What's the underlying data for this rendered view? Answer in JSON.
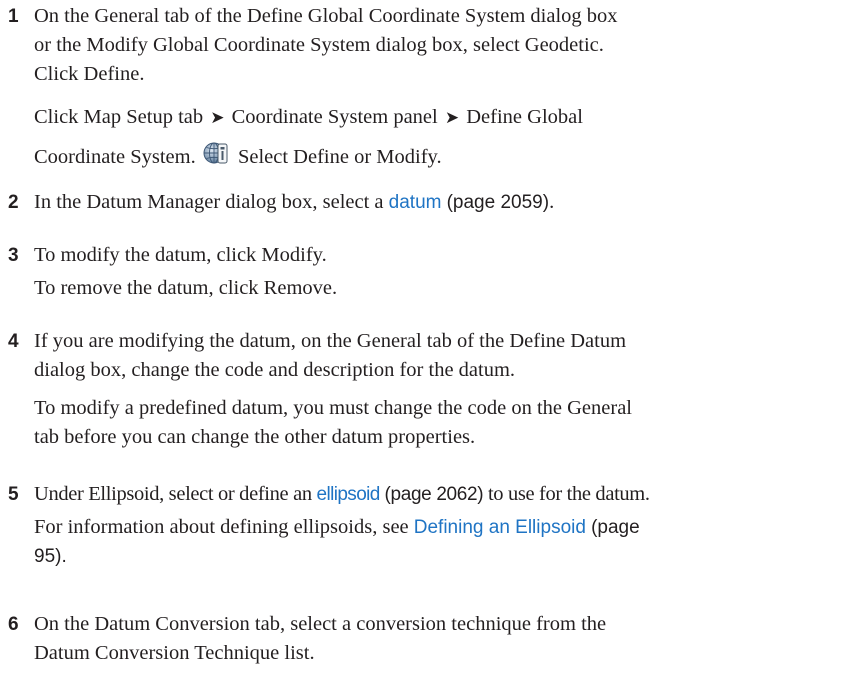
{
  "steps": [
    {
      "number": "1",
      "lines": [
        "On the General tab of the Define Global Coordinate System dialog box",
        "or the Modify Global Coordinate System dialog box, select Geodetic.",
        "Click Define."
      ],
      "nav": {
        "prefix": "Click",
        "items": [
          "Map Setup tab",
          "Coordinate System panel",
          "Define Global"
        ],
        "cont": "Coordinate System.",
        "icon": "global-coordinate-system-icon",
        "after_icon": "Select Define or Modify."
      }
    },
    {
      "number": "2",
      "before": "In the Datum Manager dialog box, select a ",
      "link": "datum",
      "page": "(page 2059)",
      "after": "."
    },
    {
      "number": "3",
      "line1": "To modify the datum, click Modify.",
      "line2": "To remove the datum, click Remove."
    },
    {
      "number": "4",
      "lines": [
        "If you are modifying the datum, on the General tab of the Define Datum",
        "dialog box, change the code and description for the datum."
      ],
      "note_lines": [
        "To modify a predefined datum, you must change the code on the General",
        "tab before you can change the other datum properties."
      ]
    },
    {
      "number": "5",
      "before": "Under Ellipsoid, select or define an ",
      "link": "ellipsoid",
      "page": "(page 2062)",
      "after": " to use for the datum.",
      "info_before": "For information about defining ellipsoids, see ",
      "info_link": "Defining an Ellipsoid",
      "info_page": "(page",
      "info_page_cont": "95)."
    },
    {
      "number": "6",
      "lines": [
        "On the Datum Conversion tab, select a conversion technique from the",
        "Datum Conversion Technique list."
      ]
    }
  ],
  "colors": {
    "text": "#231f20",
    "link": "#1f74c4"
  }
}
